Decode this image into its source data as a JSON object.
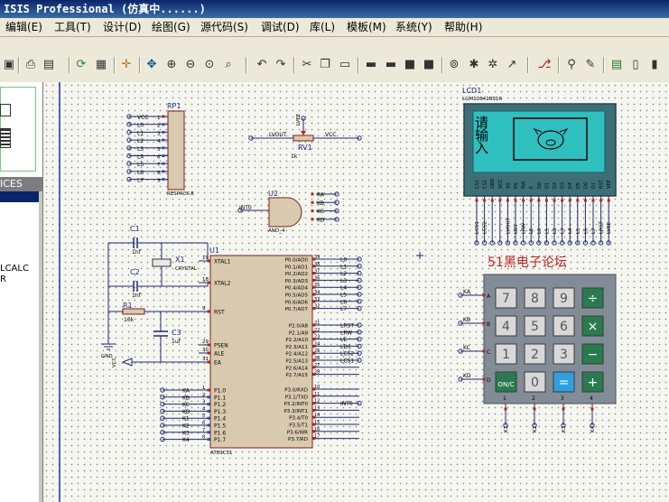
{
  "window": {
    "title": "ISIS Professional (仿真中......)"
  },
  "menu": [
    "编辑(E)",
    "工具(T)",
    "设计(D)",
    "绘图(G)",
    "源代码(S)",
    "调试(D)",
    "库(L)",
    "模板(M)",
    "系统(Y)",
    "帮助(H)"
  ],
  "left_panel": {
    "devices_header": "ICES",
    "items": [
      "LCALC",
      "R"
    ]
  },
  "schematic": {
    "rp1": {
      "ref": "RP1",
      "part": "RESPACK-8",
      "pins": [
        "VCC",
        "L0",
        "L1",
        "L2",
        "L3",
        "L4",
        "L5",
        "L6",
        "L7"
      ]
    },
    "rv1": {
      "ref": "RV1",
      "value": "1k",
      "net_left": "LVOUT",
      "net_right": "VCC",
      "top": "LVEE"
    },
    "u2": {
      "ref": "U2",
      "part": "AND_4",
      "pins": [
        "KA",
        "KB",
        "KC",
        "KD"
      ],
      "out": "INT0"
    },
    "lcd": {
      "ref": "LCD1",
      "part": "LGM12641BS1R",
      "screen_text": "请\n输\n入",
      "pins": [
        "CS1",
        "CS2",
        "GND",
        "VCC",
        "V0",
        "RS",
        "RW",
        "E",
        "D0",
        "D1",
        "D2",
        "D3",
        "D4",
        "D5",
        "D6",
        "D7",
        "RST",
        "VEE"
      ],
      "nets": [
        "LCS1",
        "LCS2",
        "",
        "",
        "LVOUT",
        "LD1",
        "LRW",
        "LE",
        "L0",
        "L1",
        "L2",
        "L3",
        "L4",
        "L5",
        "L6",
        "L7",
        "LRST",
        "LVEE"
      ]
    },
    "keypad": {
      "title": "51黑电子论坛",
      "keys": [
        "7",
        "8",
        "9",
        "÷",
        "4",
        "5",
        "6",
        "×",
        "1",
        "2",
        "3",
        "−",
        "ON/C",
        "0",
        "=",
        "+"
      ],
      "rows": [
        "KA",
        "KB",
        "KC",
        "KD"
      ],
      "row_letters": [
        "A",
        "B",
        "C",
        "D"
      ],
      "cols": [
        "K1",
        "K2",
        "K3",
        "K4"
      ],
      "col_nums": [
        "1",
        "2",
        "3",
        "4"
      ]
    },
    "c1": {
      "ref": "C1",
      "value": "1nf"
    },
    "c2": {
      "ref": "C2",
      "value": "1nf"
    },
    "x1": {
      "ref": "X1",
      "value": "CRYSTAL"
    },
    "r1": {
      "ref": "R1",
      "value": "10k"
    },
    "c3": {
      "ref": "C3",
      "value": "1uf"
    },
    "gnd": "GND",
    "vcc": "VCC",
    "u1": {
      "ref": "U1",
      "part": "AT89C51",
      "left_pins": [
        [
          "19",
          "XTAL1"
        ],
        [
          "18",
          "XTAL2"
        ],
        [
          "9",
          "RST"
        ],
        [
          "29",
          "PSEN"
        ],
        [
          "30",
          "ALE"
        ],
        [
          "31",
          "EA"
        ]
      ],
      "p1": [
        [
          "1",
          "P1.0",
          "KA"
        ],
        [
          "2",
          "P1.1",
          "KB"
        ],
        [
          "3",
          "P1.2",
          "KC"
        ],
        [
          "4",
          "P1.3",
          "KD"
        ],
        [
          "5",
          "P1.4",
          "K1"
        ],
        [
          "6",
          "P1.5",
          "K2"
        ],
        [
          "7",
          "P1.6",
          "K3"
        ],
        [
          "8",
          "P1.7",
          "K4"
        ]
      ],
      "p0": [
        [
          "39",
          "P0.0/AD0",
          "L0"
        ],
        [
          "38",
          "P0.1/AD1",
          "L1"
        ],
        [
          "37",
          "P0.2/AD2",
          "L2"
        ],
        [
          "36",
          "P0.3/AD3",
          "L3"
        ],
        [
          "35",
          "P0.4/AD4",
          "L4"
        ],
        [
          "34",
          "P0.5/AD5",
          "L5"
        ],
        [
          "33",
          "P0.6/AD6",
          "L6"
        ],
        [
          "32",
          "P0.7/AD7",
          "L7"
        ]
      ],
      "p2": [
        [
          "21",
          "P2.0/A8",
          "LRST"
        ],
        [
          "22",
          "P2.1/A9",
          "LRW"
        ],
        [
          "23",
          "P2.2/A10",
          "LE"
        ],
        [
          "24",
          "P2.3/A11",
          "LD1"
        ],
        [
          "25",
          "P2.4/A12",
          "LCS2"
        ],
        [
          "26",
          "P2.5/A13",
          "LCS1"
        ],
        [
          "27",
          "P2.6/A14",
          ""
        ],
        [
          "28",
          "P2.7/A15",
          ""
        ]
      ],
      "p3": [
        [
          "10",
          "P3.0/RXD",
          ""
        ],
        [
          "11",
          "P3.1/TXD",
          ""
        ],
        [
          "12",
          "P3.2/INT0",
          "INT0"
        ],
        [
          "13",
          "P3.3/INT1",
          ""
        ],
        [
          "14",
          "P3.4/T0",
          ""
        ],
        [
          "15",
          "P3.5/T1",
          ""
        ],
        [
          "16",
          "P3.6/WR",
          ""
        ],
        [
          "17",
          "P3.7/RD",
          ""
        ]
      ]
    }
  }
}
